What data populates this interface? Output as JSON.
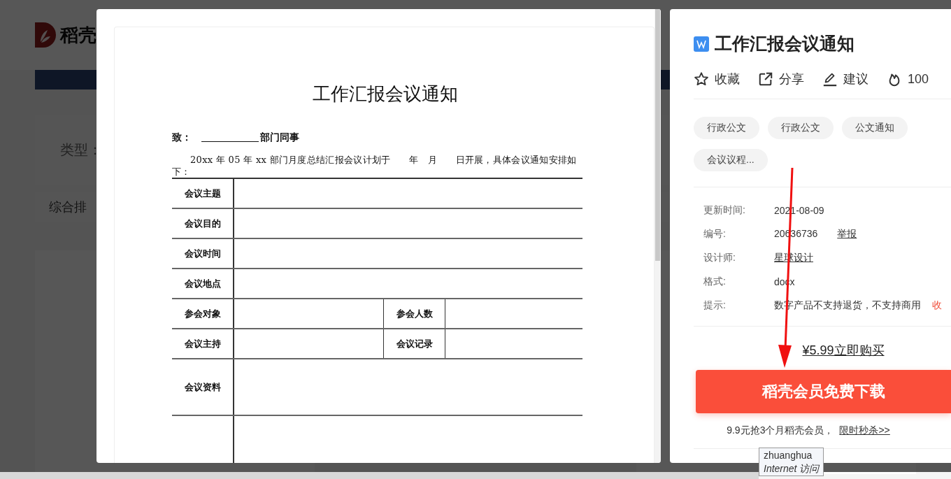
{
  "background_page": {
    "logo_text": "稻壳",
    "filter_label": "类型：",
    "sort_label": "综合排"
  },
  "preview": {
    "document": {
      "title": "工作汇报会议通知",
      "to_label": "致：",
      "to_suffix": "部门同事",
      "paragraph": "20xx 年 05 年 xx 部门月度总结汇报会议计划于　　年　月　　日开展，具体会议通知安排如下：",
      "rows": [
        {
          "cells": [
            "会议主题"
          ],
          "tall": false
        },
        {
          "cells": [
            "会议目的"
          ],
          "tall": false
        },
        {
          "cells": [
            "会议时间"
          ],
          "tall": false
        },
        {
          "cells": [
            "会议地点"
          ],
          "tall": false
        },
        {
          "cells": [
            "参会对象",
            "参会人数"
          ],
          "tall": false
        },
        {
          "cells": [
            "会议主持",
            "会议记录"
          ],
          "tall": false
        },
        {
          "cells": [
            "会议资料"
          ],
          "tall": true
        },
        {
          "cells": [],
          "tall": true
        }
      ]
    }
  },
  "details": {
    "title": "工作汇报会议通知",
    "actions": [
      {
        "kind": "star",
        "label": "收藏"
      },
      {
        "kind": "share",
        "label": "分享"
      },
      {
        "kind": "edit",
        "label": "建议"
      },
      {
        "kind": "fire",
        "label": "100"
      }
    ],
    "tags": [
      "行政公文",
      "行政公文",
      "公文通知",
      "会议议程..."
    ],
    "info": [
      {
        "label": "更新时间:",
        "value": "2021-08-09"
      },
      {
        "label": "编号:",
        "value": "20636736",
        "link": "举报"
      },
      {
        "label": "设计师:",
        "link": "星球设计"
      },
      {
        "label": "格式:",
        "value": "docx"
      },
      {
        "label": "提示:",
        "value": "数字产品不支持退货，不支持商用",
        "note": "收"
      }
    ],
    "price_link": "¥5.99立即购买",
    "download_button": "稻壳会员免费下载",
    "promo_text": "9.9元抢3个月稻壳会员，",
    "promo_link": "限时秒杀>>"
  },
  "tooltip": {
    "line_1": "zhuanghua",
    "line_2": "Internet 访问"
  }
}
